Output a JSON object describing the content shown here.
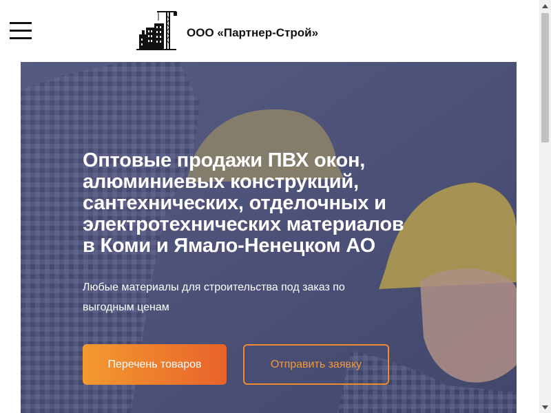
{
  "header": {
    "menu_icon": "hamburger-menu-icon",
    "logo_icon": "construction-crane-logo",
    "brand_name": "ООО «Партнер-Строй»"
  },
  "hero": {
    "title": "Оптовые продажи ПВХ окон, алюминиевых конструкций, сантехнических, отделочных и электротехнических материалов в Коми и Ямало-Ненецком АО",
    "subtitle": "Любые материалы для строительства под заказ по выгодным ценам",
    "primary_button": "Перечень товаров",
    "secondary_button": "Отправить заявку",
    "colors": {
      "overlay": "#4e5377",
      "accent_start": "#f39a30",
      "accent_end": "#e8632a",
      "outline": "#f28a2e"
    }
  },
  "scrollbar": {
    "up_icon": "arrow-up-icon",
    "down_icon": "arrow-down-icon"
  }
}
